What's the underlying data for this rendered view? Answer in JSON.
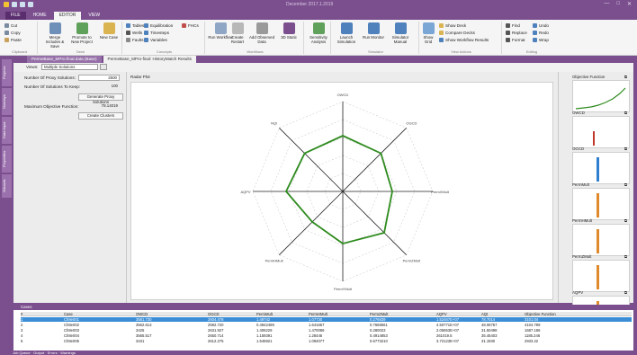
{
  "window": {
    "document_title": "December 2017.1.2019",
    "min_glyph": "—",
    "max_glyph": "□",
    "close_glyph": "✕"
  },
  "ribbon_tabs": [
    "FILE",
    "HOME",
    "EDITOR",
    "VIEW"
  ],
  "ribbon": {
    "clipboard": {
      "cut": "Cut",
      "copy": "Copy",
      "paste": "Paste",
      "label": "Clipboard"
    },
    "merge": "Merge Includes & Save",
    "promote": "Promote to New Project",
    "new_case": "New Case",
    "deck_label": "Deck",
    "tables": "Tables",
    "wells": "Wells",
    "faults": "Faults",
    "equilibration": "Equilibration",
    "timesteps": "Timesteps",
    "variables": "Variables",
    "fhcs": "FHCs",
    "concepts_label": "Concepts",
    "run_workflow": "Run Workflow",
    "create_restart": "Create Restart",
    "add_observed": "Add Observed Data",
    "workflows_label": "Workflows",
    "streamlines": "3D Static",
    "sensitivity": "Sensitivity Analysis",
    "launch": "Launch Simulation",
    "run_monitor": "Run Monitor",
    "simulator_manual": "Simulator Manual",
    "simulator_label": "Simulator",
    "show_grid": "Show Grid",
    "show_deck": "Show Deck",
    "compare_decks": "Compare Decks",
    "show_workflow": "Show Workflow Results",
    "view_actions_label": "View Actions",
    "find": "Find",
    "replace": "Replace",
    "format": "Format",
    "undo": "Undo",
    "redo": "Redo",
    "wrap": "Wrap",
    "editing_label": "Editing"
  },
  "side_tabs": [
    "Projects",
    "Overlays",
    "Data Input",
    "Properties",
    "Wizards"
  ],
  "doc_tabs": [
    "PermeBase_MPro-final.data (Base)",
    "PermeBase_MPro-final: HistoryMatch Results"
  ],
  "views": {
    "label": "Views:",
    "selected": "Multiple Solutions"
  },
  "left_panel": {
    "num_proxy_label": "Number Of Proxy Solutions:",
    "num_proxy_value": "2500",
    "num_keep_label": "Number Of Solutions To Keep:",
    "num_keep_value": "100",
    "generate_button": "Generate Proxy Solutions",
    "max_obj_label": "Maximum Objective Function:",
    "max_obj_value": "78.14019",
    "create_clusters_button": "Create Clusters"
  },
  "chart_data": {
    "type": "radar",
    "title": "Radar Plot",
    "axes": [
      "OWCD",
      "OGCD",
      "PermXMult",
      "PermZMult",
      "PermYMult",
      "PermHMult",
      "AQPV",
      "NQI"
    ],
    "values": [
      0.62,
      0.6,
      0.55,
      0.65,
      0.58,
      0.48,
      0.63,
      0.6
    ],
    "rings": 5,
    "series_color": "#2e8b1e"
  },
  "thumbnails": [
    {
      "name": "Objective Function",
      "kind": "line",
      "color": "#2e8b1e"
    },
    {
      "name": "OWCD",
      "kind": "spike",
      "color": "#c0392b"
    },
    {
      "name": "OGCD",
      "kind": "bar",
      "color": "#2f7fd0"
    },
    {
      "name": "PermMult",
      "kind": "bar",
      "color": "#e08a2e"
    },
    {
      "name": "PermHMult",
      "kind": "bar",
      "color": "#e08a2e"
    },
    {
      "name": "PermZMult",
      "kind": "bar",
      "color": "#e08a2e"
    },
    {
      "name": "AQPV",
      "kind": "bar",
      "color": "#e08a2e"
    }
  ],
  "cases": {
    "title": "Cases",
    "columns": [
      "#",
      "Case",
      "OWCD",
      "OGCD",
      "PermMult",
      "PermHMult",
      "PermZMult",
      "AQPV",
      "AQI",
      "Objective Function"
    ],
    "rows": [
      [
        "1",
        "Ch8e001",
        "3581.730",
        "2604.478",
        "1.49742",
        "1.07730",
        "0.276839",
        "1.52467E+07",
        "78.7014",
        "3101.04"
      ],
      [
        "2",
        "Ch8e002",
        "3562.613",
        "2592.720",
        "0.4942489",
        "1.641667",
        "0.7668561",
        "4.50771E+07",
        "48.06757",
        "4104.789"
      ],
      [
        "3",
        "Ch8e003",
        "3425",
        "2631.927",
        "1.406229",
        "1.470086",
        "0.280023",
        "2.05653E+07",
        "31.50498",
        "1687.186"
      ],
      [
        "4",
        "Ch8e004",
        "3565.517",
        "2650.714",
        "1.159391",
        "1.28446",
        "0.4914853",
        "261019.5",
        "35.45403",
        "1185.246"
      ],
      [
        "5",
        "Ch8e005",
        "3431",
        "2612.275",
        "1.545921",
        "1.094077",
        "0.6773210",
        "3.72123E+07",
        "31.1930",
        "2933.22"
      ]
    ]
  },
  "status": {
    "text": "Job Queue · Output · Errors · Warnings"
  }
}
